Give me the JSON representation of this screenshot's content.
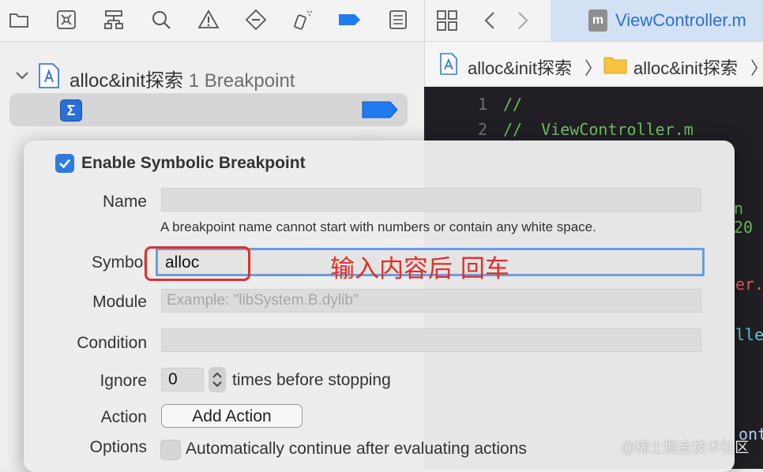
{
  "navigator": {
    "toolbar_icons": [
      "folder-icon",
      "source-control-icon",
      "hierarchy-icon",
      "search-icon",
      "warning-icon",
      "test-icon",
      "debug-icon",
      "breakpoint-icon",
      "report-icon"
    ],
    "group": {
      "file": "alloc&init探索",
      "count": "1 Breakpoint"
    }
  },
  "editor": {
    "tab_label": "ViewController.m",
    "jumpbar": {
      "project": "alloc&init探索",
      "folder": "alloc&init探索",
      "separator": "〉"
    },
    "lines": [
      {
        "num": "1",
        "text": "//"
      },
      {
        "num": "2",
        "text": "//  ViewController.m"
      }
    ],
    "fragments": {
      "year": "n 20",
      "class": "er.h",
      "ctrl": "ller",
      "cont": "ontr"
    }
  },
  "popover": {
    "enable_label": "Enable Symbolic Breakpoint",
    "name_label": "Name",
    "name_hint": "A breakpoint name cannot start with numbers or contain any white space.",
    "symbol_label": "Symbol",
    "symbol_value": "alloc",
    "annotation": "输入内容后 回车",
    "module_label": "Module",
    "module_placeholder": "Example: \"libSystem.B.dylib\"",
    "condition_label": "Condition",
    "ignore_label": "Ignore",
    "ignore_value": "0",
    "ignore_suffix": "times before stopping",
    "action_label": "Action",
    "add_action": "Add Action",
    "options_label": "Options",
    "options_text": "Automatically continue after evaluating actions"
  },
  "watermark": "@稀土掘金技术社区",
  "colors": {
    "accent": "#2b7be0",
    "annotation": "#e0302a",
    "tab_text": "#2d6fd0",
    "code_comment": "#6fbf5f"
  }
}
